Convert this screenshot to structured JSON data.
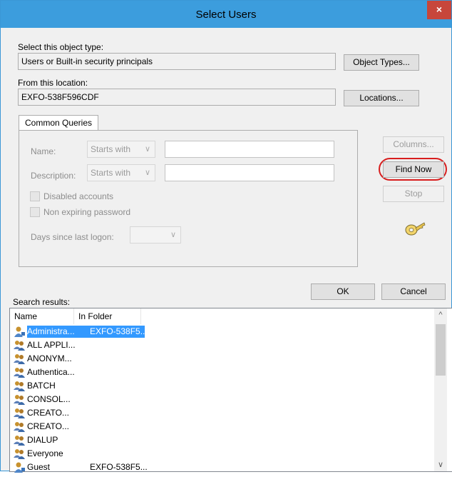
{
  "window": {
    "title": "Select Users",
    "close_label": "×"
  },
  "object_type": {
    "label": "Select this object type:",
    "value": "Users or Built-in security principals",
    "button": "Object Types..."
  },
  "location": {
    "label": "From this location:",
    "value": "EXFO-538F596CDF",
    "button": "Locations..."
  },
  "tab": {
    "label": "Common Queries"
  },
  "queries": {
    "name_label": "Name:",
    "name_mode": "Starts with",
    "description_label": "Description:",
    "description_mode": "Starts with",
    "disabled_label": "Disabled accounts",
    "nonexpiring_label": "Non expiring password",
    "days_label": "Days since last logon:",
    "days_value": ""
  },
  "side_buttons": {
    "columns": "Columns...",
    "find_now": "Find Now",
    "stop": "Stop"
  },
  "dialog_buttons": {
    "ok": "OK",
    "cancel": "Cancel"
  },
  "search_results": {
    "label": "Search results:",
    "columns": [
      "Name",
      "In Folder"
    ],
    "rows": [
      {
        "name": "Administra...",
        "folder": "EXFO-538F5...",
        "icon": "user-icon",
        "selected": true
      },
      {
        "name": "ALL APPLI...",
        "folder": "",
        "icon": "group-icon"
      },
      {
        "name": "ANONYM...",
        "folder": "",
        "icon": "group-icon"
      },
      {
        "name": "Authentica...",
        "folder": "",
        "icon": "group-icon"
      },
      {
        "name": "BATCH",
        "folder": "",
        "icon": "group-icon"
      },
      {
        "name": "CONSOL...",
        "folder": "",
        "icon": "group-icon"
      },
      {
        "name": "CREATO...",
        "folder": "",
        "icon": "group-icon"
      },
      {
        "name": "CREATO...",
        "folder": "",
        "icon": "group-icon"
      },
      {
        "name": "DIALUP",
        "folder": "",
        "icon": "group-icon"
      },
      {
        "name": "Everyone",
        "folder": "",
        "icon": "group-icon"
      },
      {
        "name": "Guest",
        "folder": "EXFO-538F5...",
        "icon": "user-icon"
      }
    ]
  },
  "colors": {
    "titlebar": "#3c9ddd",
    "close": "#c7463b",
    "highlight_ring": "#d81e1e",
    "selection": "#3399ff"
  }
}
